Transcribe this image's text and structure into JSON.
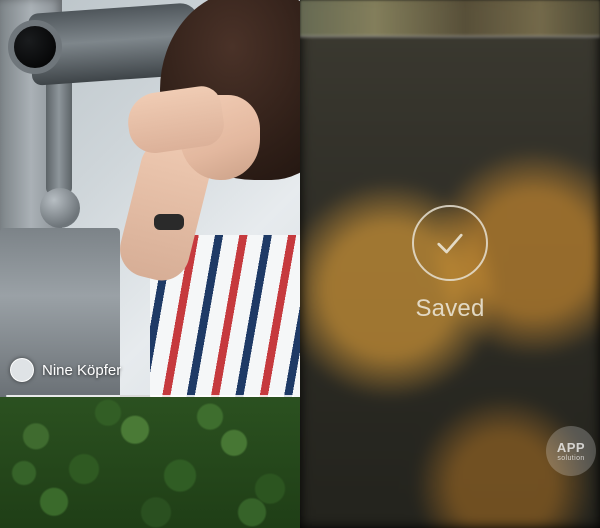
{
  "left": {
    "top_photo": {
      "author_name": "Nine Köpfer"
    }
  },
  "right": {
    "toast": {
      "label": "Saved",
      "icon": "check-icon"
    },
    "watermark": {
      "main": "APP",
      "sub": "solution"
    }
  }
}
